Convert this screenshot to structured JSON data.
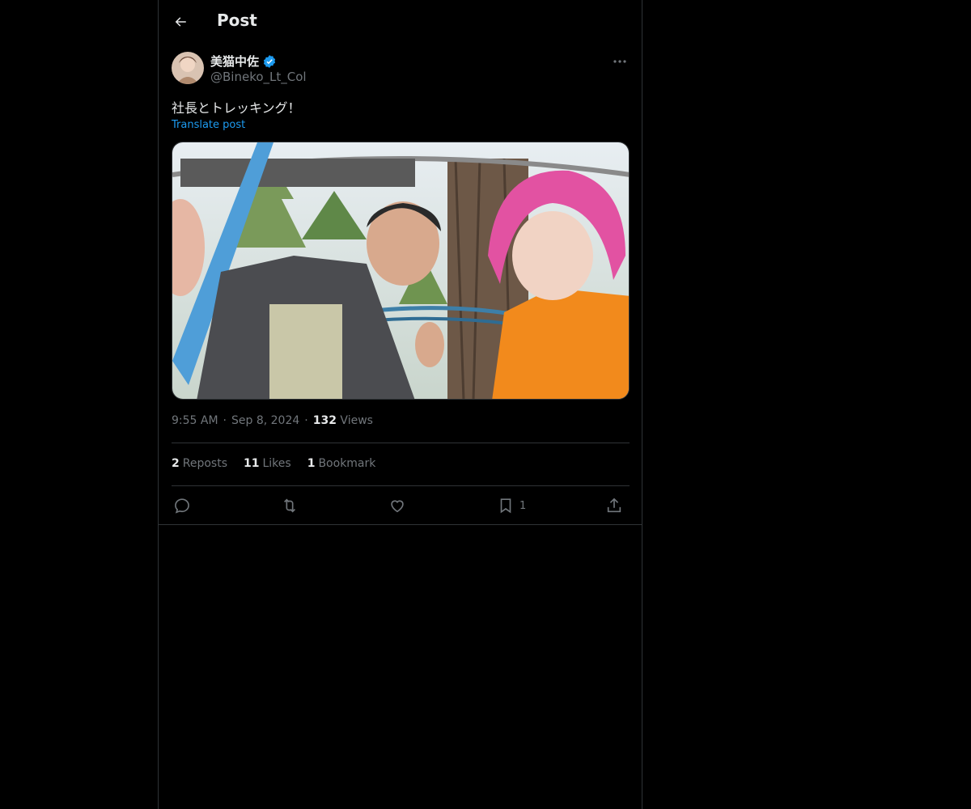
{
  "header": {
    "title": "Post"
  },
  "author": {
    "display_name": "美猫中佐",
    "handle": "@Bineko_Lt_Col",
    "verified": true,
    "verified_color": "#1d9bf0"
  },
  "post": {
    "text": "社長とトレッキング！",
    "translate_label": "Translate post",
    "time": "9:55 AM",
    "date": "Sep 8, 2024",
    "views_count": "132",
    "views_label": "Views",
    "separator": "·"
  },
  "stats": [
    {
      "count": "2",
      "label": "Reposts"
    },
    {
      "count": "11",
      "label": "Likes"
    },
    {
      "count": "1",
      "label": "Bookmark"
    }
  ],
  "actions": {
    "reply": {
      "icon": "reply-icon"
    },
    "repost": {
      "icon": "repost-icon"
    },
    "like": {
      "icon": "heart-icon"
    },
    "bookmark": {
      "icon": "bookmark-icon",
      "count": "1"
    },
    "share": {
      "icon": "share-icon"
    }
  },
  "colors": {
    "background": "#000000",
    "border": "#2f3336",
    "text_primary": "#e7e9ea",
    "text_secondary": "#71767b",
    "accent": "#1d9bf0"
  }
}
